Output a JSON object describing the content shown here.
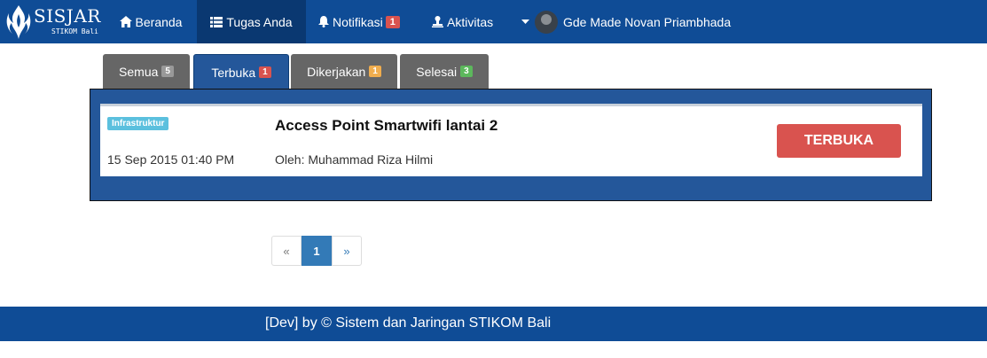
{
  "brand": {
    "title": "SISJAR",
    "subtitle": "STIKOM Bali"
  },
  "nav": {
    "home": {
      "label": "Beranda",
      "icon": "home-icon"
    },
    "tasks": {
      "label": "Tugas Anda",
      "icon": "list-icon"
    },
    "notifications": {
      "label": "Notifikasi",
      "badge": "1",
      "icon": "bell-icon"
    },
    "activity": {
      "label": "Aktivitas",
      "icon": "stamp-icon"
    },
    "user": {
      "name": "Gde Made Novan Priambhada",
      "icon": "caret-down-icon"
    }
  },
  "tabs": [
    {
      "label": "Semua",
      "count": "5",
      "badge_color": "#999999"
    },
    {
      "label": "Terbuka",
      "count": "1",
      "badge_color": "#d9534f",
      "active": true
    },
    {
      "label": "Dikerjakan",
      "count": "1",
      "badge_color": "#f0ad4e"
    },
    {
      "label": "Selesai",
      "count": "3",
      "badge_color": "#5cb85c"
    }
  ],
  "task": {
    "category": "Infrastruktur",
    "date": "15 Sep 2015 01:40 PM",
    "title": "Access Point Smartwifi lantai 2",
    "author": "Oleh: Muhammad Riza Hilmi",
    "status": "TERBUKA"
  },
  "pagination": {
    "prev": "«",
    "current": "1",
    "next": "»"
  },
  "footer": {
    "text": "[Dev] by © Sistem dan Jaringan STIKOM Bali"
  },
  "colors": {
    "navbar": "#0f4c96",
    "panel": "#24579a",
    "status": "#d9534f"
  }
}
